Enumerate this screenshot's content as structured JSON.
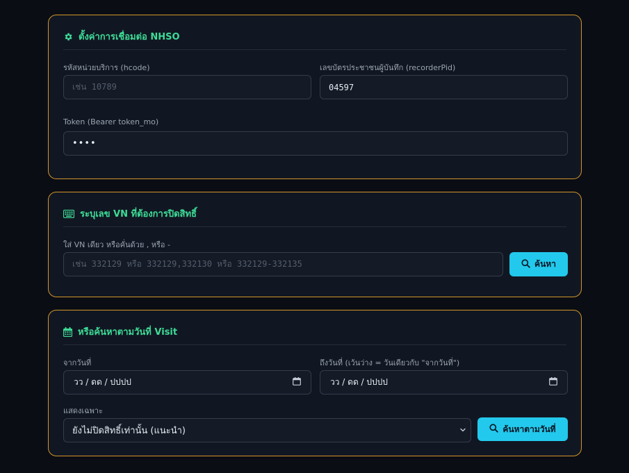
{
  "colors": {
    "accent_green": "#3ddc97",
    "card_border": "#d4952a",
    "button_cyan": "#22c9ec",
    "background": "#0a0d14"
  },
  "nhso_settings": {
    "title": "ตั้งค่าการเชื่อมต่อ NHSO",
    "icon": "gear-icon",
    "hcode": {
      "label": "รหัสหน่วยบริการ (hcode)",
      "placeholder": "เช่น 10789",
      "value": ""
    },
    "recorder_pid": {
      "label": "เลขบัตรประชาชนผู้บันทึก (recorderPid)",
      "value": "04597"
    },
    "token": {
      "label": "Token (Bearer token_mo)",
      "value": "••••"
    }
  },
  "vn_search": {
    "title": "ระบุเลข VN ที่ต้องการปิดสิทธิ์",
    "icon": "keyboard-icon",
    "label": "ใส่ VN เดียว หรือคั่นด้วย , หรือ -",
    "placeholder": "เช่น 332129 หรือ 332129,332130 หรือ 332129-332135",
    "button_label": "ค้นหา",
    "button_icon": "search-icon"
  },
  "date_search": {
    "title": "หรือค้นหาตามวันที่ Visit",
    "icon": "calendar-icon",
    "from_label": "จากวันที่",
    "from_value": "วว / ดด / ปปปป",
    "to_label": "ถึงวันที่ (เว้นว่าง = วันเดียวกับ \"จากวันที่\")",
    "to_value": "วว / ดด / ปปปป",
    "filter_label": "แสดงเฉพาะ",
    "filter_selected": "ยังไม่ปิดสิทธิ์เท่านั้น (แนะนำ)",
    "button_label": "ค้นหาตามวันที่",
    "button_icon": "search-icon"
  }
}
